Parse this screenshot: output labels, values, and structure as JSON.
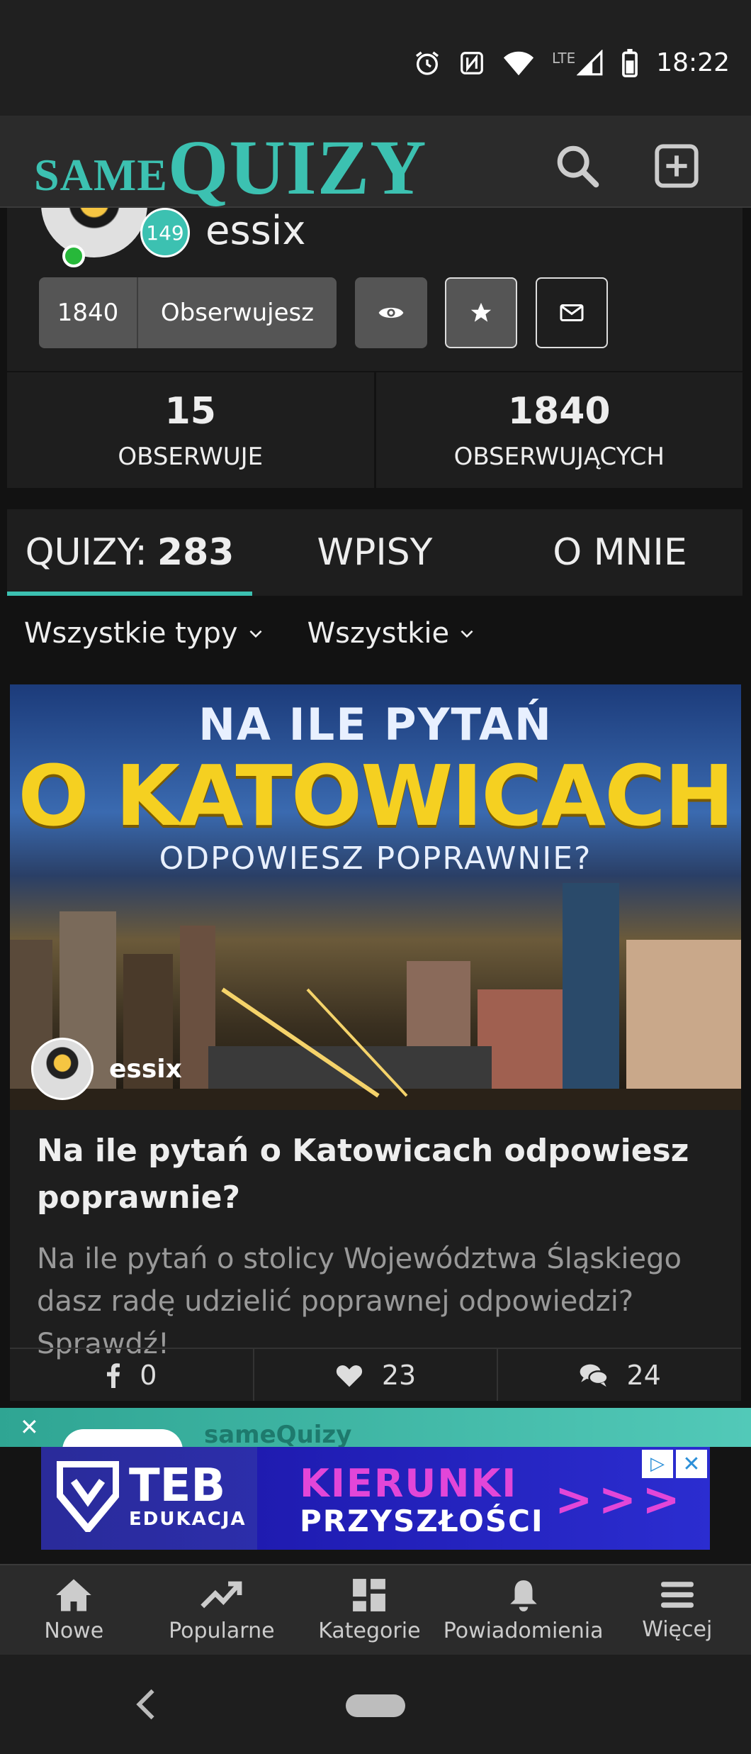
{
  "status_bar": {
    "time": "18:22",
    "network": "LTE"
  },
  "app": {
    "logo_small": "SAME",
    "logo_big": "QUIZY"
  },
  "profile": {
    "username": "essix",
    "level": "149",
    "followers_count": "1840",
    "follow_state": "Obserwujesz"
  },
  "stats": [
    {
      "value": "15",
      "label": "OBSERWUJE"
    },
    {
      "value": "1840",
      "label": "OBSERWUJĄCYCH"
    }
  ],
  "tabs": [
    {
      "label": "QUIZY:",
      "count": "283",
      "active": true
    },
    {
      "label": "WPISY"
    },
    {
      "label": "O MNIE"
    }
  ],
  "filters": {
    "type": "Wszystkie typy",
    "scope": "Wszystkie"
  },
  "quiz": {
    "image_line1": "NA ILE PYTAŃ",
    "image_line2": "O KATOWICACH",
    "image_line3": "ODPOWIESZ POPRAWNIE?",
    "author": "essix",
    "title": "Na ile pytań o Katowicach odpowiesz poprawnie?",
    "description": "Na ile pytań o stolicy Województwa Śląskiego dasz radę udzielić poprawnej odpowiedzi? Sprawdź!",
    "facebook_shares": "0",
    "likes": "23",
    "comments": "24"
  },
  "ad": {
    "strip_brand": "sameQuizy",
    "logo_main": "TEB",
    "logo_sub": "EDUKACJA",
    "line1": "KIERUNKI",
    "line2": "PRZYSZŁOŚCI",
    "arrows": ">>>"
  },
  "bottom_nav": [
    {
      "label": "Nowe",
      "icon": "home-icon"
    },
    {
      "label": "Popularne",
      "icon": "trending-icon"
    },
    {
      "label": "Kategorie",
      "icon": "grid-icon"
    },
    {
      "label": "Powiadomienia",
      "icon": "bell-icon"
    },
    {
      "label": "Więcej",
      "icon": "menu-icon"
    }
  ],
  "colors": {
    "accent": "#3cc1b1",
    "online": "#27b83a",
    "background": "#121212",
    "card": "#1e1e1e"
  }
}
